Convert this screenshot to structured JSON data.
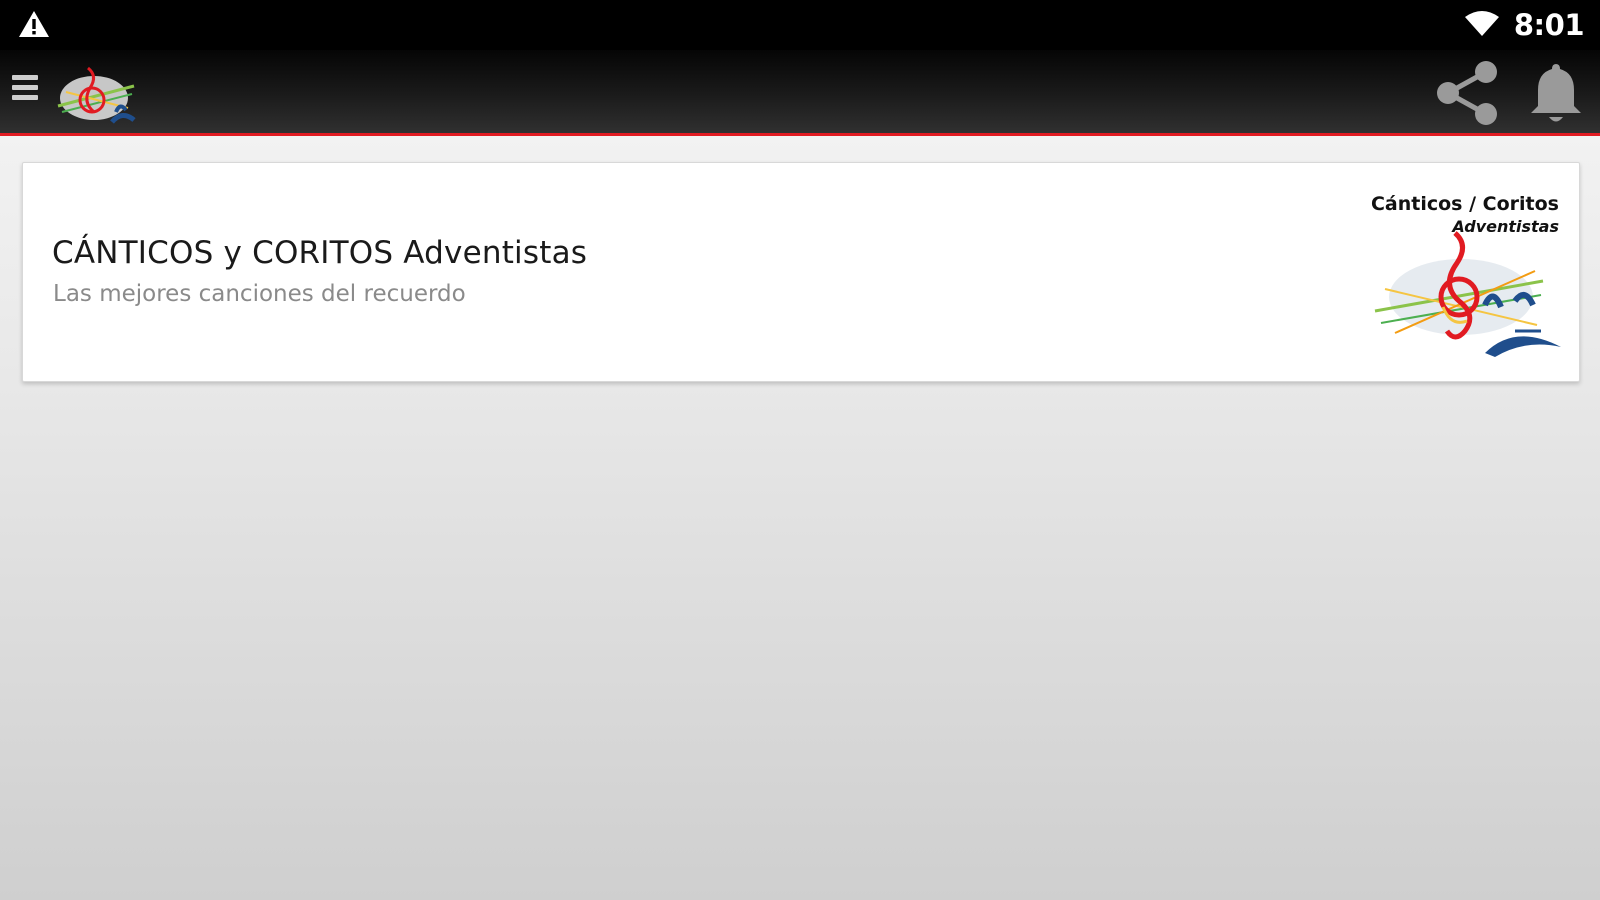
{
  "status_bar": {
    "time": "8:01",
    "icons": [
      "warning-icon",
      "wifi-icon"
    ]
  },
  "app_bar": {
    "icons": [
      "menu-icon",
      "app-logo",
      "share-icon",
      "bell-icon"
    ]
  },
  "cards": [
    {
      "title": "CÁNTICOS y CORITOS Adventistas",
      "subtitle": "Las mejores canciones del recuerdo",
      "logo_text_line1": "Cánticos / Coritos",
      "logo_text_line2": "Adventistas"
    }
  ],
  "colors": {
    "accent": "#e11b22",
    "app_bar": "#1b1b1b",
    "status_bar": "#000000"
  }
}
